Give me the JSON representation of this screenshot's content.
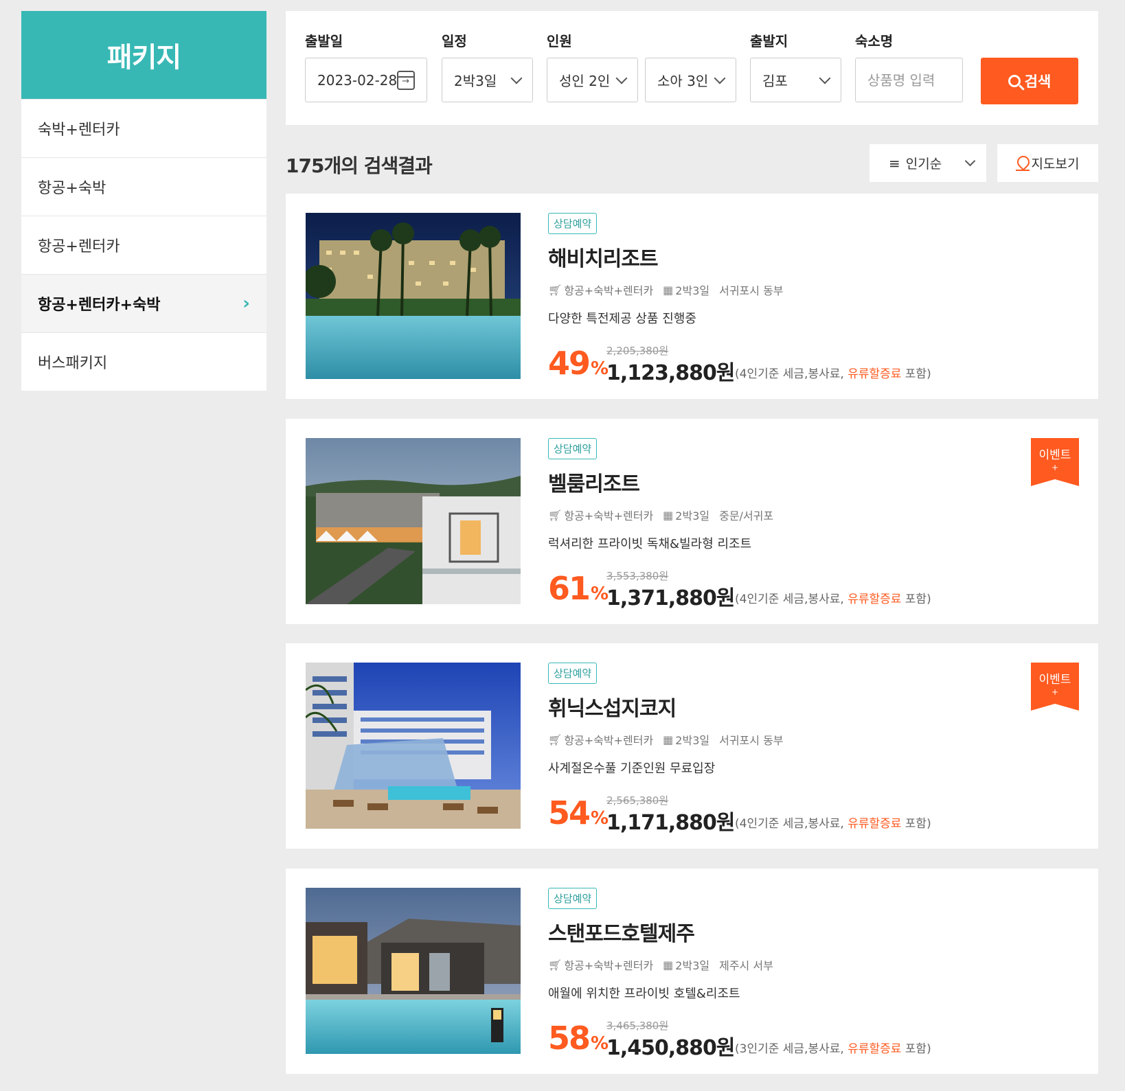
{
  "sidebar": {
    "title": "패키지",
    "items": [
      {
        "label": "숙박+렌터카"
      },
      {
        "label": "항공+숙박"
      },
      {
        "label": "항공+렌터카"
      },
      {
        "label": "항공+렌터카+숙박",
        "active": true,
        "chevron": "›"
      },
      {
        "label": "버스패키지"
      }
    ]
  },
  "search": {
    "depart_label": "출발일",
    "depart_value": "2023-02-28",
    "schedule_label": "일정",
    "schedule_value": "2박3일",
    "people_label": "인원",
    "adult_value": "성인 2인",
    "child_value": "소아 3인",
    "origin_label": "출발지",
    "origin_value": "김포",
    "name_label": "숙소명",
    "name_placeholder": "상품명 입력",
    "button_label": "검색"
  },
  "results": {
    "count_text": "175개의 검색결과",
    "sort_label": "인기순",
    "map_label": "지도보기"
  },
  "colors": {
    "accent_teal": "#37b8b5",
    "accent_orange": "#ff5a1f"
  },
  "cards": [
    {
      "badge": "상담예약",
      "name": "해비치리조트",
      "type": "항공+숙박+렌터카",
      "duration": "2박3일",
      "location": "서귀포시 동부",
      "desc": "다양한 특전제공 상품 진행중",
      "discount": "49",
      "pct": "%",
      "original": "2,205,380원",
      "price": "1,123,880원",
      "note_a": "(4인기준 세금,봉사료, ",
      "note_hl": "유류할증료",
      "note_b": " 포함)",
      "event": false
    },
    {
      "badge": "상담예약",
      "name": "벨룸리조트",
      "type": "항공+숙박+렌터카",
      "duration": "2박3일",
      "location": "중문/서귀포",
      "desc": "럭셔리한 프라이빗 독채&빌라형 리조트",
      "discount": "61",
      "pct": "%",
      "original": "3,553,380원",
      "price": "1,371,880원",
      "note_a": "(4인기준 세금,봉사료, ",
      "note_hl": "유류할증료",
      "note_b": " 포함)",
      "event": true,
      "event_label": "이벤트",
      "event_plus": "+"
    },
    {
      "badge": "상담예약",
      "name": "휘닉스섭지코지",
      "type": "항공+숙박+렌터카",
      "duration": "2박3일",
      "location": "서귀포시 동부",
      "desc": "사계절온수풀 기준인원 무료입장",
      "discount": "54",
      "pct": "%",
      "original": "2,565,380원",
      "price": "1,171,880원",
      "note_a": "(4인기준 세금,봉사료, ",
      "note_hl": "유류할증료",
      "note_b": " 포함)",
      "event": true,
      "event_label": "이벤트",
      "event_plus": "+"
    },
    {
      "badge": "상담예약",
      "name": "스탠포드호텔제주",
      "type": "항공+숙박+렌터카",
      "duration": "2박3일",
      "location": "제주시 서부",
      "desc": "애월에 위치한 프라이빗 호텔&리조트",
      "discount": "58",
      "pct": "%",
      "original": "3,465,380원",
      "price": "1,450,880원",
      "note_a": "(3인기준 세금,봉사료, ",
      "note_hl": "유류할증료",
      "note_b": " 포함)",
      "event": false
    }
  ]
}
